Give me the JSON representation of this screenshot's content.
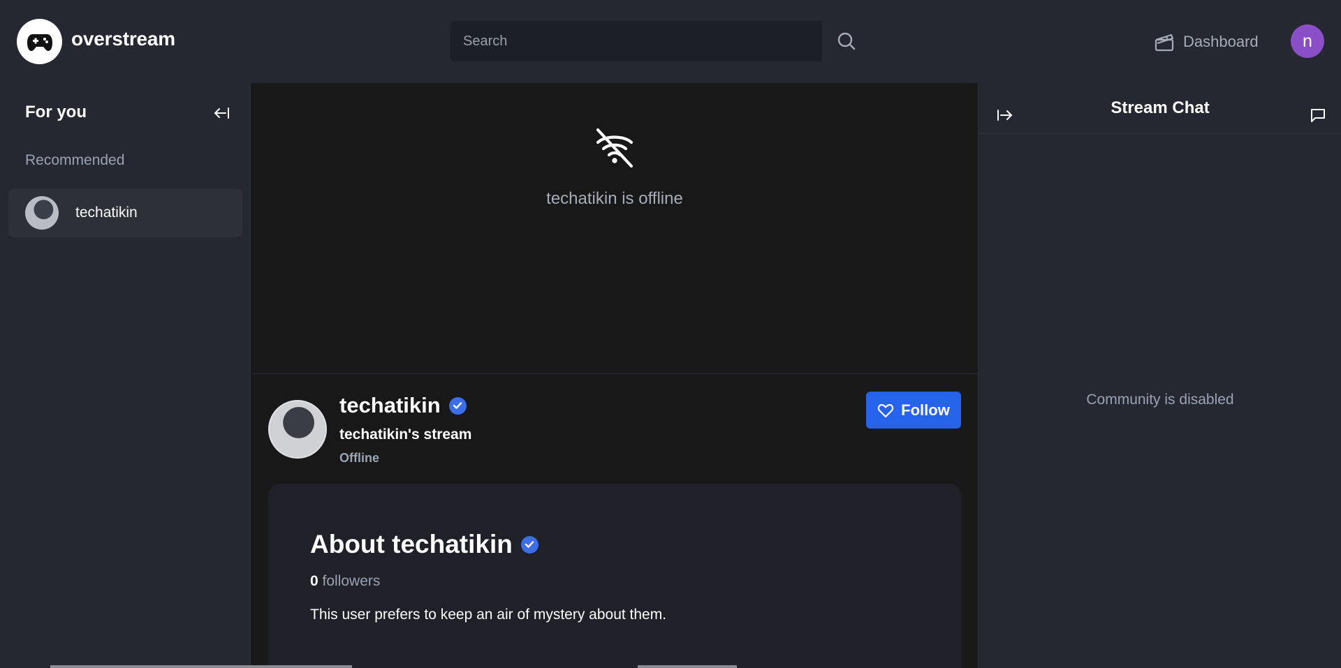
{
  "header": {
    "brand": "overstream",
    "search": {
      "placeholder": "Search",
      "value": ""
    },
    "dashboard_label": "Dashboard",
    "user_initial": "n",
    "icons": {
      "logo": "gamepad-icon",
      "search": "search-icon",
      "dashboard": "clapperboard-icon"
    }
  },
  "sidebar": {
    "title": "For you",
    "section": "Recommended",
    "items": [
      {
        "label": "techatikin"
      }
    ],
    "icons": {
      "collapse": "arrow-left-to-line-icon"
    }
  },
  "player": {
    "offline_message": "techatikin is offline",
    "icons": {
      "offline": "wifi-off-icon"
    }
  },
  "profile": {
    "name": "techatikin",
    "stream_title": "techatikin's stream",
    "status": "Offline",
    "follow_label": "Follow",
    "verified": true
  },
  "about": {
    "title": "About techatikin",
    "followers_count": "0",
    "followers_label": "followers",
    "bio": "This user prefers to keep an air of mystery about them."
  },
  "chat": {
    "title": "Stream Chat",
    "disabled_message": "Community is disabled",
    "icons": {
      "expand": "arrow-right-to-line-icon",
      "mode": "message-square-icon"
    }
  },
  "colors": {
    "accent": "#2563eb",
    "verified": "#3b6ee8",
    "user_avatar": "#8a4fc7",
    "panel": "#252731",
    "background": "#181818"
  }
}
